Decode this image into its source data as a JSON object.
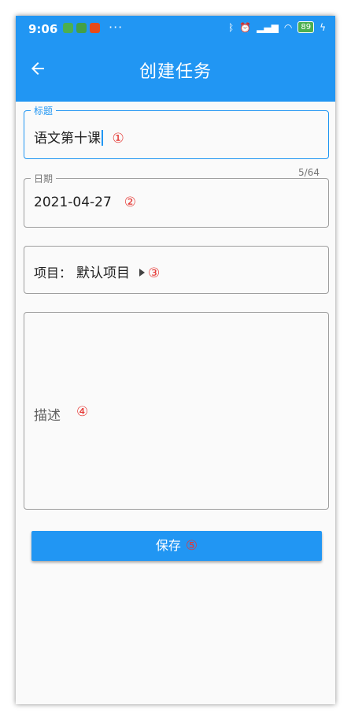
{
  "status_bar": {
    "time": "9:06",
    "more": "···",
    "battery": "89"
  },
  "app_bar": {
    "title": "创建任务"
  },
  "form": {
    "title_field": {
      "label": "标题",
      "value": "语文第十课",
      "marker": "①",
      "counter": "5/64"
    },
    "date_field": {
      "label": "日期",
      "value": "2021-04-27",
      "marker": "②"
    },
    "project_field": {
      "label": "项目：",
      "value": "默认项目",
      "marker": "③"
    },
    "description_field": {
      "placeholder": "描述",
      "marker": "④"
    },
    "save_button": {
      "label": "保存",
      "marker": "⑤"
    }
  },
  "colors": {
    "primary": "#2196f3",
    "marker_red": "#e53935",
    "border": "#9e9e9e"
  }
}
